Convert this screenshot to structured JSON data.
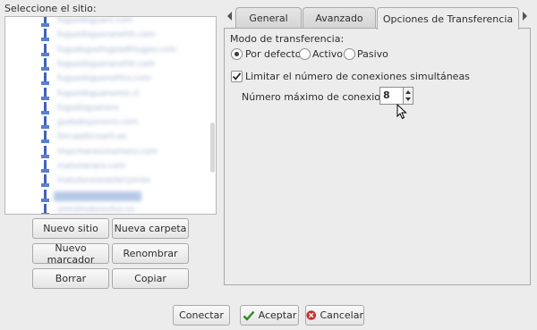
{
  "left": {
    "site_label": "Seleccione el sitio:",
    "sites": [
      "fuguodoguani.com",
      "fuguodoguoranehtt.com",
      "fugudoguofugoadhtugoo.com",
      "fuguodoguoranehtt.com",
      "fuguodoguonohtrs.com",
      "fuguodoguanomis.cl",
      "fugudoguanoro",
      "gudadoyoronro.com",
      "forcaadiciuarh.es",
      "impcmenesmamero.com",
      "inatunanaro.com",
      "inatutoneseaoleriyerex",
      "sehorelucatinetioaera",
      "shmdmdoroufuo.es"
    ],
    "selected_index": 12,
    "buttons": {
      "new_site": "Nuevo sitio",
      "new_folder": "Nueva carpeta",
      "new_bookmark": "Nuevo marcador",
      "rename": "Renombrar",
      "delete": "Borrar",
      "copy": "Copiar"
    }
  },
  "tabs": {
    "general": "General",
    "advanced": "Avanzado",
    "transfer": "Opciones de Transferencia",
    "active": "transfer"
  },
  "transfer": {
    "mode_label": "Modo de transferencia:",
    "mode_options": [
      "Por defecto",
      "Activo",
      "Pasivo"
    ],
    "mode_selected": "Por defecto",
    "limit_label": "Limitar el número de conexiones simultáneas",
    "limit_checked": true,
    "max_label": "Número máximo de conexiones",
    "max_value": "8"
  },
  "footer": {
    "connect": "Conectar",
    "accept": "Aceptar",
    "cancel": "Cancelar"
  },
  "colors": {
    "accent_check": "#2f8a1f",
    "cancel_icon": "#c83030"
  }
}
